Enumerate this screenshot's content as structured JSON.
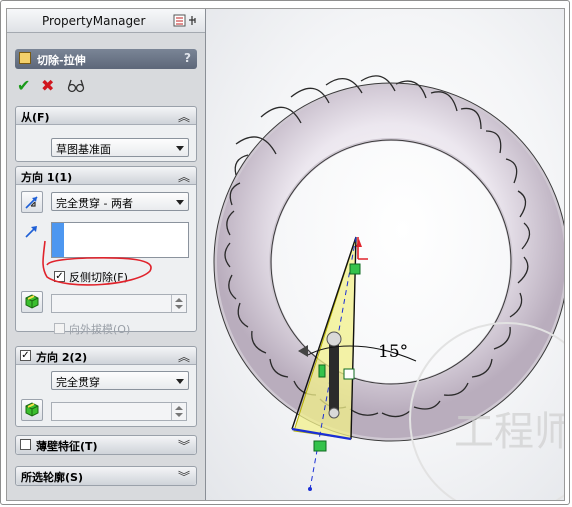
{
  "pm": {
    "title": "PropertyManager"
  },
  "feature": {
    "title": "切除-拉伸",
    "help": "?"
  },
  "actions": {
    "ok": "✔",
    "cancel": "✖",
    "preview": "6ϭ"
  },
  "from": {
    "title": "从(F)",
    "value": "草图基准面"
  },
  "dir1": {
    "title": "方向 1(1)",
    "end_condition": "完全贯穿 - 两者",
    "flip_side_label": "反侧切除(F)",
    "flip_side_checked": true,
    "draft_outward_label": "向外拔模(O)"
  },
  "dir2": {
    "title": "方向 2(2)",
    "checked": true,
    "end_condition": "完全贯穿"
  },
  "thin": {
    "title": "薄壁特征(T)"
  },
  "contours": {
    "title": "所选轮廓(S)"
  },
  "viewport": {
    "angle_label": "15°",
    "watermark": "工程师"
  },
  "colors": {
    "accent": "#1e7cff",
    "annotation": "#e0232c",
    "preview": "#f2f08a"
  }
}
